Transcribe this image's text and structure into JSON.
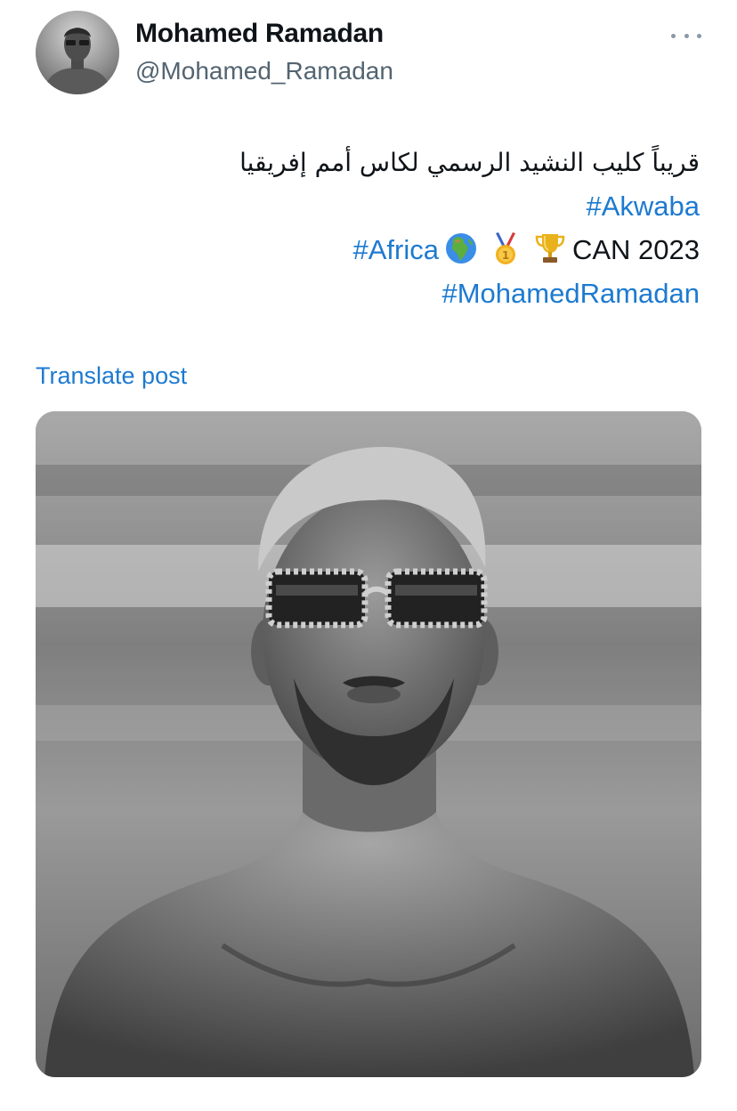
{
  "author": {
    "display_name": "Mohamed Ramadan",
    "handle": "@Mohamed_Ramadan"
  },
  "post": {
    "arabic_text": "قريباً كليب النشيد الرسمي لكاس أمم إفريقيا",
    "hashtag_akwaba": "#Akwaba",
    "hashtag_africa": "#Africa",
    "can_text": "CAN 2023",
    "hashtag_mohamed": "#MohamedRamadan",
    "emojis": [
      "globe-africa-icon",
      "gold-medal-icon",
      "trophy-icon"
    ]
  },
  "translate_label": "Translate post",
  "colors": {
    "link": "#1d7ad0",
    "secondary_text": "#536471",
    "primary_text": "#0f1419"
  }
}
